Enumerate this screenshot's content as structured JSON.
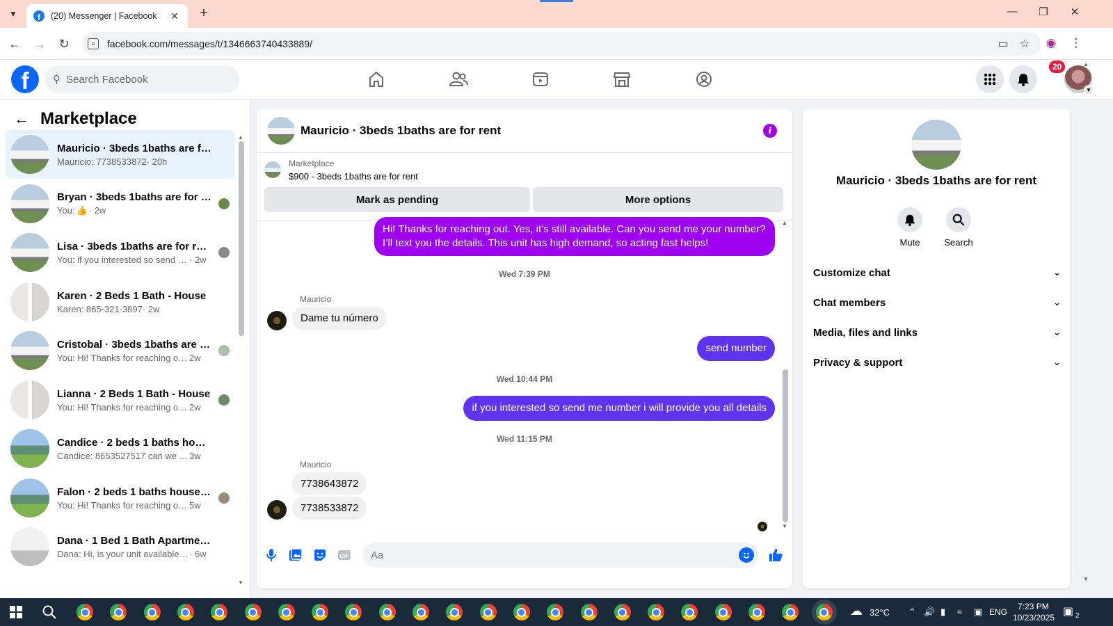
{
  "browser": {
    "tab_title": "(20) Messenger | Facebook",
    "url": "facebook.com/messages/t/1346663740433889/"
  },
  "fb": {
    "search_placeholder": "Search Facebook",
    "notification_count": "20",
    "brand_color": "#0866ff"
  },
  "sidebar": {
    "title": "Marketplace",
    "conversations": [
      {
        "name": "Mauricio · 3beds 1baths are for r...",
        "preview": "Mauricio: 7738533872",
        "time": "· 20h",
        "thumb": "house1",
        "active": true
      },
      {
        "name": "Bryan · 3beds 1baths are for r...",
        "preview": "You: ",
        "time": " · 2w",
        "thumb": "house1",
        "like": true
      },
      {
        "name": "Lisa · 3beds 1baths are for rent",
        "preview": "You: if you interested so send m...",
        "time": " · 2w",
        "thumb": "house1"
      },
      {
        "name": "Karen · 2 Beds 1 Bath - House",
        "preview": "Karen: 865-321-3897",
        "time": " · 2w",
        "thumb": "house2"
      },
      {
        "name": "Cristobal · 3beds 1baths are fo...",
        "preview": "You: Hi! Thanks for reaching out....",
        "time": " 2w",
        "thumb": "house1"
      },
      {
        "name": "Lianna · 2 Beds 1 Bath - House",
        "preview": "You: Hi! Thanks for reaching out....",
        "time": " 2w",
        "thumb": "house2"
      },
      {
        "name": "Candice · 2 beds 1 baths house /...",
        "preview": "Candice: 8653527517 can we come...",
        "time": " 3w",
        "thumb": "house3"
      },
      {
        "name": "Falon · 2 beds 1 baths house / ...",
        "preview": "You: Hi! Thanks for reaching out....",
        "time": " 5w",
        "thumb": "house3"
      },
      {
        "name": "Dana · 1 Bed 1 Bath Apartment/c...",
        "preview": "Dana: Hi, is your unit available for ...",
        "time": " · 6w",
        "thumb": "house4"
      }
    ]
  },
  "chat": {
    "title": "Mauricio · 3beds 1baths are for rent",
    "listing_source": "Marketplace",
    "listing_detail": "$900 - 3beds 1baths are for rent",
    "mark_pending": "Mark as pending",
    "more_options": "More options",
    "msg_out_1": "Hi! Thanks for reaching out. Yes, it’s still available. Can you send me your number? I’ll text you the details. This unit has high demand, so acting fast helps!",
    "stamp_1": "Wed 7:39 PM",
    "sender_1": "Mauricio",
    "msg_in_1": "Dame tu número",
    "msg_out_2": "send number",
    "stamp_2": "Wed 10:44 PM",
    "msg_out_3": "if you interested so send me number i will provide you all details",
    "stamp_3": "Wed 11:15 PM",
    "sender_2": "Mauricio",
    "msg_in_2": "7738643872",
    "msg_in_3": "7738533872",
    "composer_placeholder": "Aa",
    "out_color": "#9e00f0"
  },
  "info": {
    "name": "Mauricio · 3beds 1baths are for rent",
    "mute": "Mute",
    "search": "Search",
    "rows": [
      "Customize chat",
      "Chat members",
      "Media, files and links",
      "Privacy & support"
    ]
  },
  "taskbar": {
    "temperature": "32°C",
    "lang": "ENG",
    "time": "7:23 PM",
    "date": "10/23/2025",
    "notification_count": "2"
  }
}
